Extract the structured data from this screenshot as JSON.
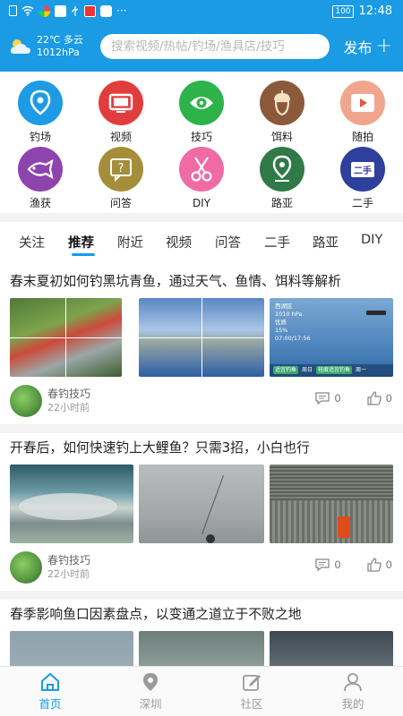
{
  "status_bar": {
    "battery": "100",
    "time": "12:48"
  },
  "header": {
    "temperature": "22℃ 多云",
    "pressure": "1012hPa",
    "search_placeholder": "搜索视频/热帖/钓场/渔具店/技巧",
    "publish_label": "发布"
  },
  "grid": [
    {
      "label": "钓场",
      "color": "#1e9be4",
      "icon": "location-pin-icon"
    },
    {
      "label": "视频",
      "color": "#e23d3d",
      "icon": "tv-icon"
    },
    {
      "label": "技巧",
      "color": "#2db34a",
      "icon": "eye-icon"
    },
    {
      "label": "饵料",
      "color": "#8a5a3b",
      "icon": "acorn-icon"
    },
    {
      "label": "随拍",
      "color": "#f2a58e",
      "icon": "play-icon"
    },
    {
      "label": "渔获",
      "color": "#8e44ad",
      "icon": "fish-icon"
    },
    {
      "label": "问答",
      "color": "#a58e3a",
      "icon": "question-chat-icon"
    },
    {
      "label": "DIY",
      "color": "#f06aa4",
      "icon": "scissors-icon"
    },
    {
      "label": "路亚",
      "color": "#2f7a47",
      "icon": "map-pin-icon"
    },
    {
      "label": "二手",
      "color": "#2e3f9c",
      "icon": "second-hand-icon",
      "badge": "二手"
    }
  ],
  "tabs": [
    "关注",
    "推荐",
    "附近",
    "视频",
    "问答",
    "二手",
    "路亚",
    "DIY"
  ],
  "active_tab": "推荐",
  "posts": [
    {
      "title": "春末夏初如何钓黑坑青鱼，通过天气、鱼情、饵料等解析",
      "author": "春钓技巧",
      "time": "22小时前",
      "comments": "0",
      "likes": "0",
      "weather_panel": {
        "place": "西湖区",
        "pressure": "1010 hPa",
        "condition": "优质",
        "percent": "15%",
        "clock": "07:00/17:56",
        "day_a": "周日",
        "day_b": "周一",
        "tag_a": "适宜钓鱼",
        "tag_b": "轻度适宜钓鱼"
      }
    },
    {
      "title": "开春后，如何快速钓上大鲤鱼？只需3招，小白也行",
      "author": "春钓技巧",
      "time": "22小时前",
      "comments": "0",
      "likes": "0"
    },
    {
      "title": "春季影响鱼口因素盘点，以变通之道立于不败之地"
    }
  ],
  "bottom_nav": [
    {
      "label": "首页",
      "icon": "home-icon",
      "active": true
    },
    {
      "label": "深圳",
      "icon": "location-icon",
      "active": false
    },
    {
      "label": "社区",
      "icon": "edit-icon",
      "active": false
    },
    {
      "label": "我的",
      "icon": "person-icon",
      "active": false
    }
  ],
  "colors": {
    "brand_blue": "#1a9be4"
  }
}
